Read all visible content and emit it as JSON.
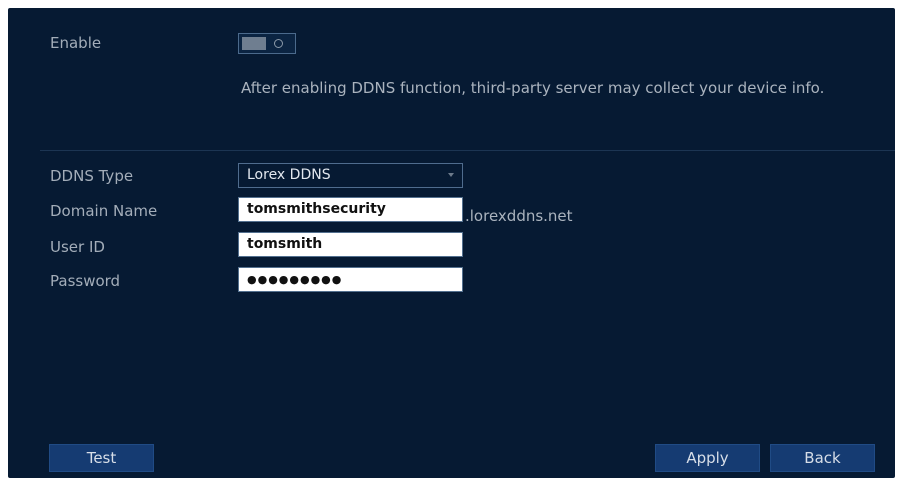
{
  "form": {
    "enable": {
      "label": "Enable"
    },
    "notice": "After enabling DDNS function, third-party server may collect your device info.",
    "ddns_type": {
      "label": "DDNS Type",
      "value": "Lorex DDNS"
    },
    "domain_name": {
      "label": "Domain Name",
      "value": "tomsmithsecurity",
      "suffix": ".lorexddns.net"
    },
    "user_id": {
      "label": "User ID",
      "value": "tomsmith"
    },
    "password": {
      "label": "Password",
      "mask": "●●●●●●●●●"
    }
  },
  "buttons": {
    "test": "Test",
    "apply": "Apply",
    "back": "Back"
  },
  "colors": {
    "panel_bg": "#061a33",
    "button_bg": "#153b72",
    "label": "#a3adb9"
  }
}
